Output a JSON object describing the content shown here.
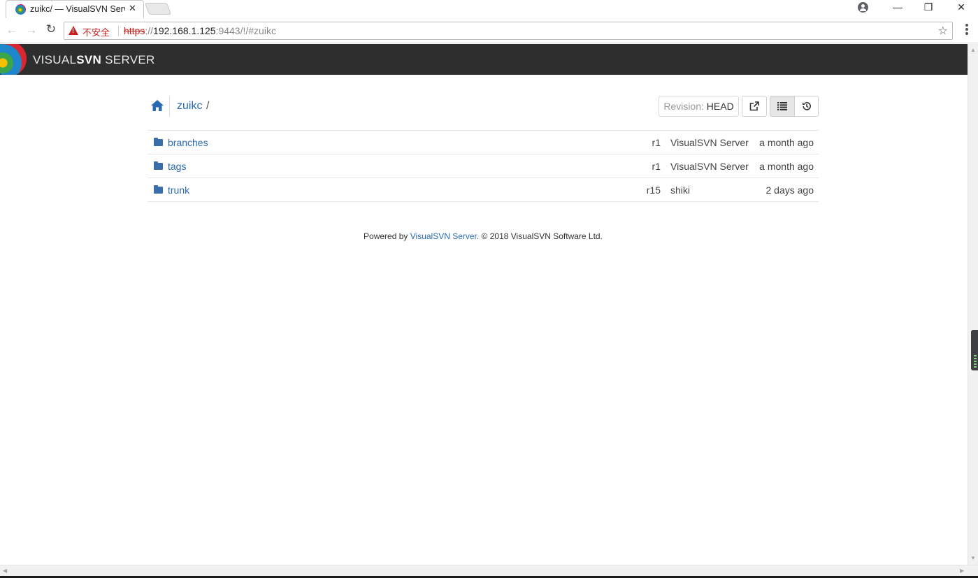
{
  "browser": {
    "tab_title": "zuikc/ — VisualSVN Server",
    "tab_close": "✕",
    "security_warning": "不安全",
    "url_scheme": "https",
    "url_sep": "://",
    "url_host": "192.168.1.125",
    "url_rest": ":9443/!/#zuikc"
  },
  "app": {
    "brand_prefix": "VISUAL",
    "brand_bold": "SVN",
    "brand_suffix": " SERVER"
  },
  "breadcrumb": {
    "repo": "zuikc",
    "slash": "/"
  },
  "toolbar": {
    "revision_label": "Revision: ",
    "revision_value": "HEAD"
  },
  "files": [
    {
      "name": "branches",
      "rev": "r1",
      "author": "VisualSVN Server",
      "date": "a month ago"
    },
    {
      "name": "tags",
      "rev": "r1",
      "author": "VisualSVN Server",
      "date": "a month ago"
    },
    {
      "name": "trunk",
      "rev": "r15",
      "author": "shiki",
      "date": "2 days ago"
    }
  ],
  "footer": {
    "prefix": "Powered by ",
    "link": "VisualSVN Server",
    "suffix": ". © 2018 VisualSVN Software Ltd."
  },
  "colors": {
    "header_bg": "#2e2e2e",
    "link": "#2a6ab2",
    "warning": "#c5221f"
  }
}
